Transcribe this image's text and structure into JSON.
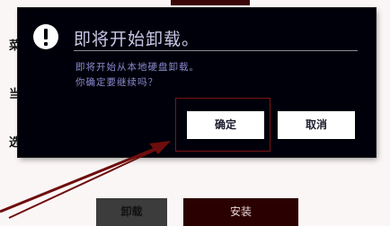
{
  "background": {
    "label_1": "菜",
    "label_2": "当",
    "label_3": "选",
    "uninstall_label": "卸载",
    "install_label": "安装"
  },
  "dialog": {
    "icon": "info-icon",
    "title": "即将开始卸载。",
    "message_line_1": "即将开始从本地硬盘卸载。",
    "message_line_2": "你确定要继续吗？",
    "confirm_label": "确定",
    "cancel_label": "取消"
  },
  "colors": {
    "dialog_bg": "#00000a",
    "title_text": "#c9c7e6",
    "message_text": "#8b8bd0",
    "highlight": "#7a1515",
    "install_bg": "#2b0000"
  }
}
